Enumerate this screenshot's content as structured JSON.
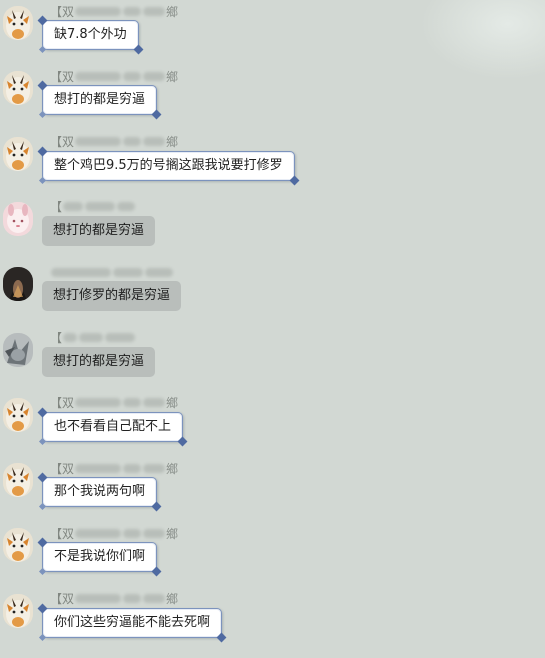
{
  "messages": [
    {
      "name_pre": "【双",
      "name_post": "鄉",
      "blur_widths": [
        46,
        18,
        22
      ],
      "text": "缺7.8个外功",
      "style": "fancy",
      "avatar": "tiger-avatar"
    },
    {
      "name_pre": "【双",
      "name_post": "鄉",
      "blur_widths": [
        46,
        18,
        22
      ],
      "text": "想打的都是穷逼",
      "style": "fancy",
      "avatar": "tiger-avatar"
    },
    {
      "name_pre": "【双",
      "name_post": "鄉",
      "blur_widths": [
        46,
        18,
        22
      ],
      "text": "整个鸡巴9.5万的号搁这跟我说要打修罗",
      "style": "fancy",
      "avatar": "tiger-avatar"
    },
    {
      "name_pre": "【",
      "name_post": "",
      "blur_widths": [
        20,
        30,
        18
      ],
      "text": "想打的都是穷逼",
      "style": "plain",
      "avatar": "pink-avatar"
    },
    {
      "name_pre": "",
      "name_post": "",
      "blur_widths": [
        60,
        30,
        28
      ],
      "text": "想打修罗的都是穷逼",
      "style": "plain",
      "avatar": "dark-avatar"
    },
    {
      "name_pre": "【",
      "name_post": "",
      "blur_widths": [
        14,
        24,
        30
      ],
      "text": "想打的都是穷逼",
      "style": "plain",
      "avatar": "gray-avatar"
    },
    {
      "name_pre": "【双",
      "name_post": "鄉",
      "blur_widths": [
        46,
        18,
        22
      ],
      "text": "也不看看自己配不上",
      "style": "fancy",
      "avatar": "tiger-avatar"
    },
    {
      "name_pre": "【双",
      "name_post": "鄉",
      "blur_widths": [
        46,
        18,
        22
      ],
      "text": "那个我说两句啊",
      "style": "fancy",
      "avatar": "tiger-avatar"
    },
    {
      "name_pre": "【双",
      "name_post": "鄉",
      "blur_widths": [
        46,
        18,
        22
      ],
      "text": "不是我说你们啊",
      "style": "fancy",
      "avatar": "tiger-avatar"
    },
    {
      "name_pre": "【双",
      "name_post": "鄉",
      "blur_widths": [
        46,
        18,
        22
      ],
      "text": "你们这些穷逼能不能去死啊",
      "style": "fancy",
      "avatar": "tiger-avatar"
    }
  ]
}
